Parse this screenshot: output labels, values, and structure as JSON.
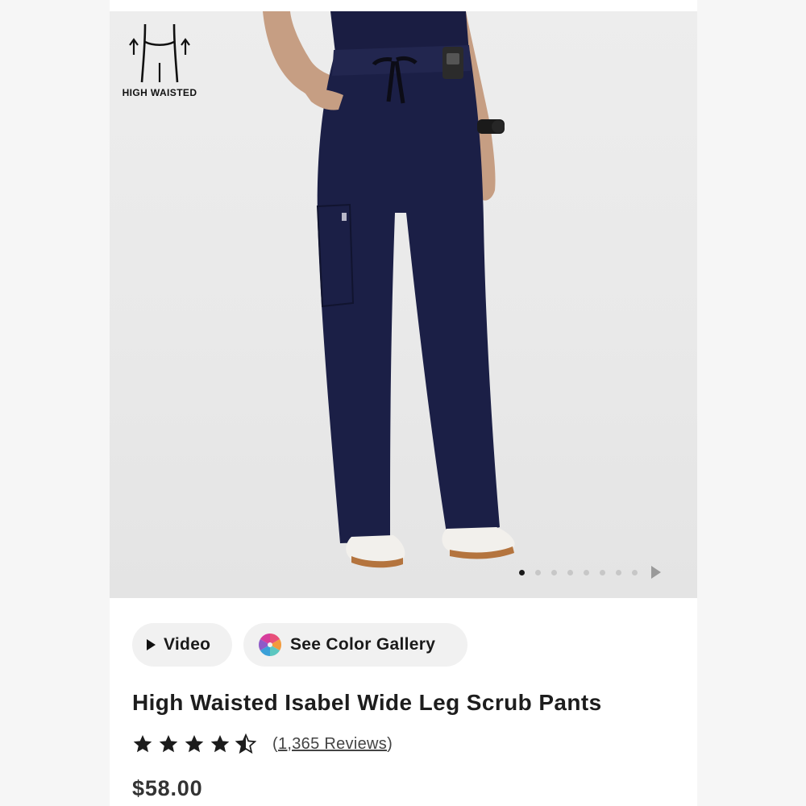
{
  "badge": {
    "label": "HIGH WAISTED",
    "icon": "high-waist-icon"
  },
  "carousel": {
    "total_images": 8,
    "active_index": 0
  },
  "buttons": {
    "video_label": "Video",
    "gallery_label": "See Color Gallery"
  },
  "product": {
    "title": "High Waisted Isabel Wide Leg Scrub Pants",
    "rating": 4.5,
    "review_count_label": "1,365 Reviews",
    "review_open": "(",
    "review_close": ")",
    "price": "$58.00"
  },
  "colors": {
    "pants": "#1b1f46",
    "background": "#ededed",
    "text": "#1d1d1d"
  }
}
